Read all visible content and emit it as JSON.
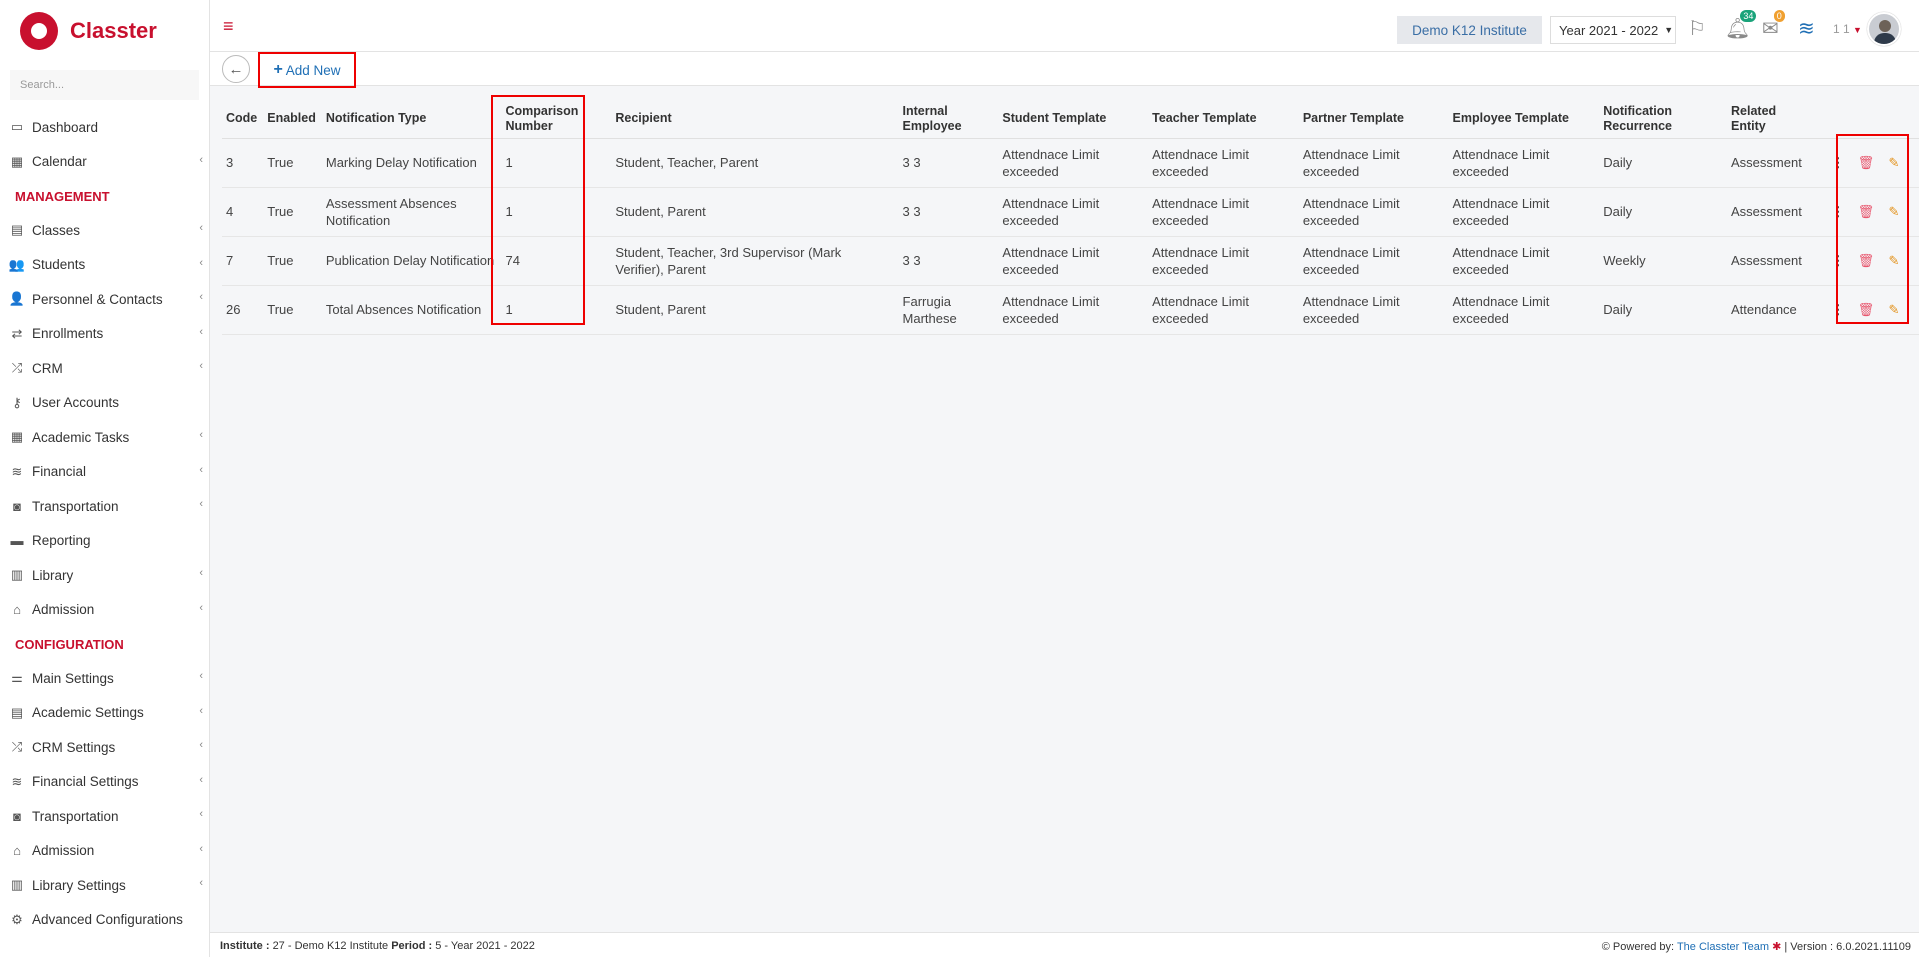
{
  "app": {
    "name": "Classter"
  },
  "sidebar": {
    "search_placeholder": "Search...",
    "items_top": [
      {
        "label": "Dashboard",
        "icon": "monitor-icon",
        "glyph": "▭",
        "chevron": false
      },
      {
        "label": "Calendar",
        "icon": "calendar-icon",
        "glyph": "▦",
        "chevron": true
      }
    ],
    "management_label": "MANAGEMENT",
    "management": [
      {
        "label": "Classes",
        "icon": "classes-icon",
        "glyph": "▤",
        "chevron": true
      },
      {
        "label": "Students",
        "icon": "students-icon",
        "glyph": "👥",
        "chevron": true
      },
      {
        "label": "Personnel & Contacts",
        "icon": "personnel-icon",
        "glyph": "👤",
        "chevron": true
      },
      {
        "label": "Enrollments",
        "icon": "enrollments-icon",
        "glyph": "⇄",
        "chevron": true
      },
      {
        "label": "CRM",
        "icon": "crm-icon",
        "glyph": "⤮",
        "chevron": true
      },
      {
        "label": "User Accounts",
        "icon": "key-icon",
        "glyph": "⚷",
        "chevron": false
      },
      {
        "label": "Academic Tasks",
        "icon": "tasks-icon",
        "glyph": "▦",
        "chevron": true
      },
      {
        "label": "Financial",
        "icon": "coins-icon",
        "glyph": "≋",
        "chevron": true
      },
      {
        "label": "Transportation",
        "icon": "bus-icon",
        "glyph": "◙",
        "chevron": true
      },
      {
        "label": "Reporting",
        "icon": "printer-icon",
        "glyph": "▬",
        "chevron": false
      },
      {
        "label": "Library",
        "icon": "library-icon",
        "glyph": "▥",
        "chevron": true
      },
      {
        "label": "Admission",
        "icon": "institution-icon",
        "glyph": "⌂",
        "chevron": true
      }
    ],
    "configuration_label": "CONFIGURATION",
    "configuration": [
      {
        "label": "Main Settings",
        "icon": "sliders-icon",
        "glyph": "⚌",
        "chevron": true
      },
      {
        "label": "Academic Settings",
        "icon": "academic-settings-icon",
        "glyph": "▤",
        "chevron": true
      },
      {
        "label": "CRM Settings",
        "icon": "crm-settings-icon",
        "glyph": "⤮",
        "chevron": true
      },
      {
        "label": "Financial Settings",
        "icon": "coins-icon",
        "glyph": "≋",
        "chevron": true
      },
      {
        "label": "Transportation",
        "icon": "bus-icon",
        "glyph": "◙",
        "chevron": true
      },
      {
        "label": "Admission",
        "icon": "institution-icon",
        "glyph": "⌂",
        "chevron": true
      },
      {
        "label": "Library Settings",
        "icon": "library-icon",
        "glyph": "▥",
        "chevron": true
      },
      {
        "label": "Advanced Configurations",
        "icon": "cogs-icon",
        "glyph": "⚙",
        "chevron": false
      }
    ]
  },
  "topbar": {
    "institute": "Demo K12 Institute",
    "year": "Year 2021 - 2022",
    "notifications_count": "34",
    "messages_count": "0",
    "user_initials": "1 1"
  },
  "toolbar": {
    "add_new_label": "Add New"
  },
  "table": {
    "headers": [
      [
        "Code"
      ],
      [
        "Enabled"
      ],
      [
        "Notification Type"
      ],
      [
        "Comparison",
        "Number"
      ],
      [
        "Recipient"
      ],
      [
        "Internal",
        "Employee"
      ],
      [
        "Student Template"
      ],
      [
        "Teacher Template"
      ],
      [
        "Partner Template"
      ],
      [
        "Employee Template"
      ],
      [
        "Notification",
        "Recurrence"
      ],
      [
        "Related",
        "Entity"
      ]
    ],
    "rows": [
      {
        "code": "3",
        "enabled": "True",
        "type": "Marking Delay Notification",
        "comparison": "1",
        "recipient": "Student, Teacher, Parent",
        "employee": "3 3",
        "student_tpl": "Attendnace Limit exceeded",
        "teacher_tpl": "Attendnace Limit exceeded",
        "partner_tpl": "Attendnace Limit exceeded",
        "employee_tpl": "Attendnace Limit exceeded",
        "recurrence": "Daily",
        "entity": "Assessment"
      },
      {
        "code": "4",
        "enabled": "True",
        "type": "Assessment Absences Notification",
        "comparison": "1",
        "recipient": "Student, Parent",
        "employee": "3 3",
        "student_tpl": "Attendnace Limit exceeded",
        "teacher_tpl": "Attendnace Limit exceeded",
        "partner_tpl": "Attendnace Limit exceeded",
        "employee_tpl": "Attendnace Limit exceeded",
        "recurrence": "Daily",
        "entity": "Assessment"
      },
      {
        "code": "7",
        "enabled": "True",
        "type": "Publication Delay Notification",
        "comparison": "74",
        "recipient": "Student, Teacher, 3rd Supervisor (Mark Verifier), Parent",
        "employee": "3 3",
        "student_tpl": "Attendnace Limit exceeded",
        "teacher_tpl": "Attendnace Limit exceeded",
        "partner_tpl": "Attendnace Limit exceeded",
        "employee_tpl": "Attendnace Limit exceeded",
        "recurrence": "Weekly",
        "entity": "Assessment"
      },
      {
        "code": "26",
        "enabled": "True",
        "type": "Total Absences Notification",
        "comparison": "1",
        "recipient": "Student, Parent",
        "employee": "Farrugia Marthese",
        "student_tpl": "Attendnace Limit exceeded",
        "teacher_tpl": "Attendnace Limit exceeded",
        "partner_tpl": "Attendnace Limit exceeded",
        "employee_tpl": "Attendnace Limit exceeded",
        "recurrence": "Daily",
        "entity": "Attendance"
      }
    ]
  },
  "footer": {
    "institute_label": "Institute :",
    "institute_value": "27 - Demo K12 Institute",
    "period_label": "Period :",
    "period_value": "5 - Year 2021 - 2022",
    "powered_by": "Powered by:",
    "team_link": "The Classter Team",
    "version": "| Version : 6.0.2021.11109"
  }
}
